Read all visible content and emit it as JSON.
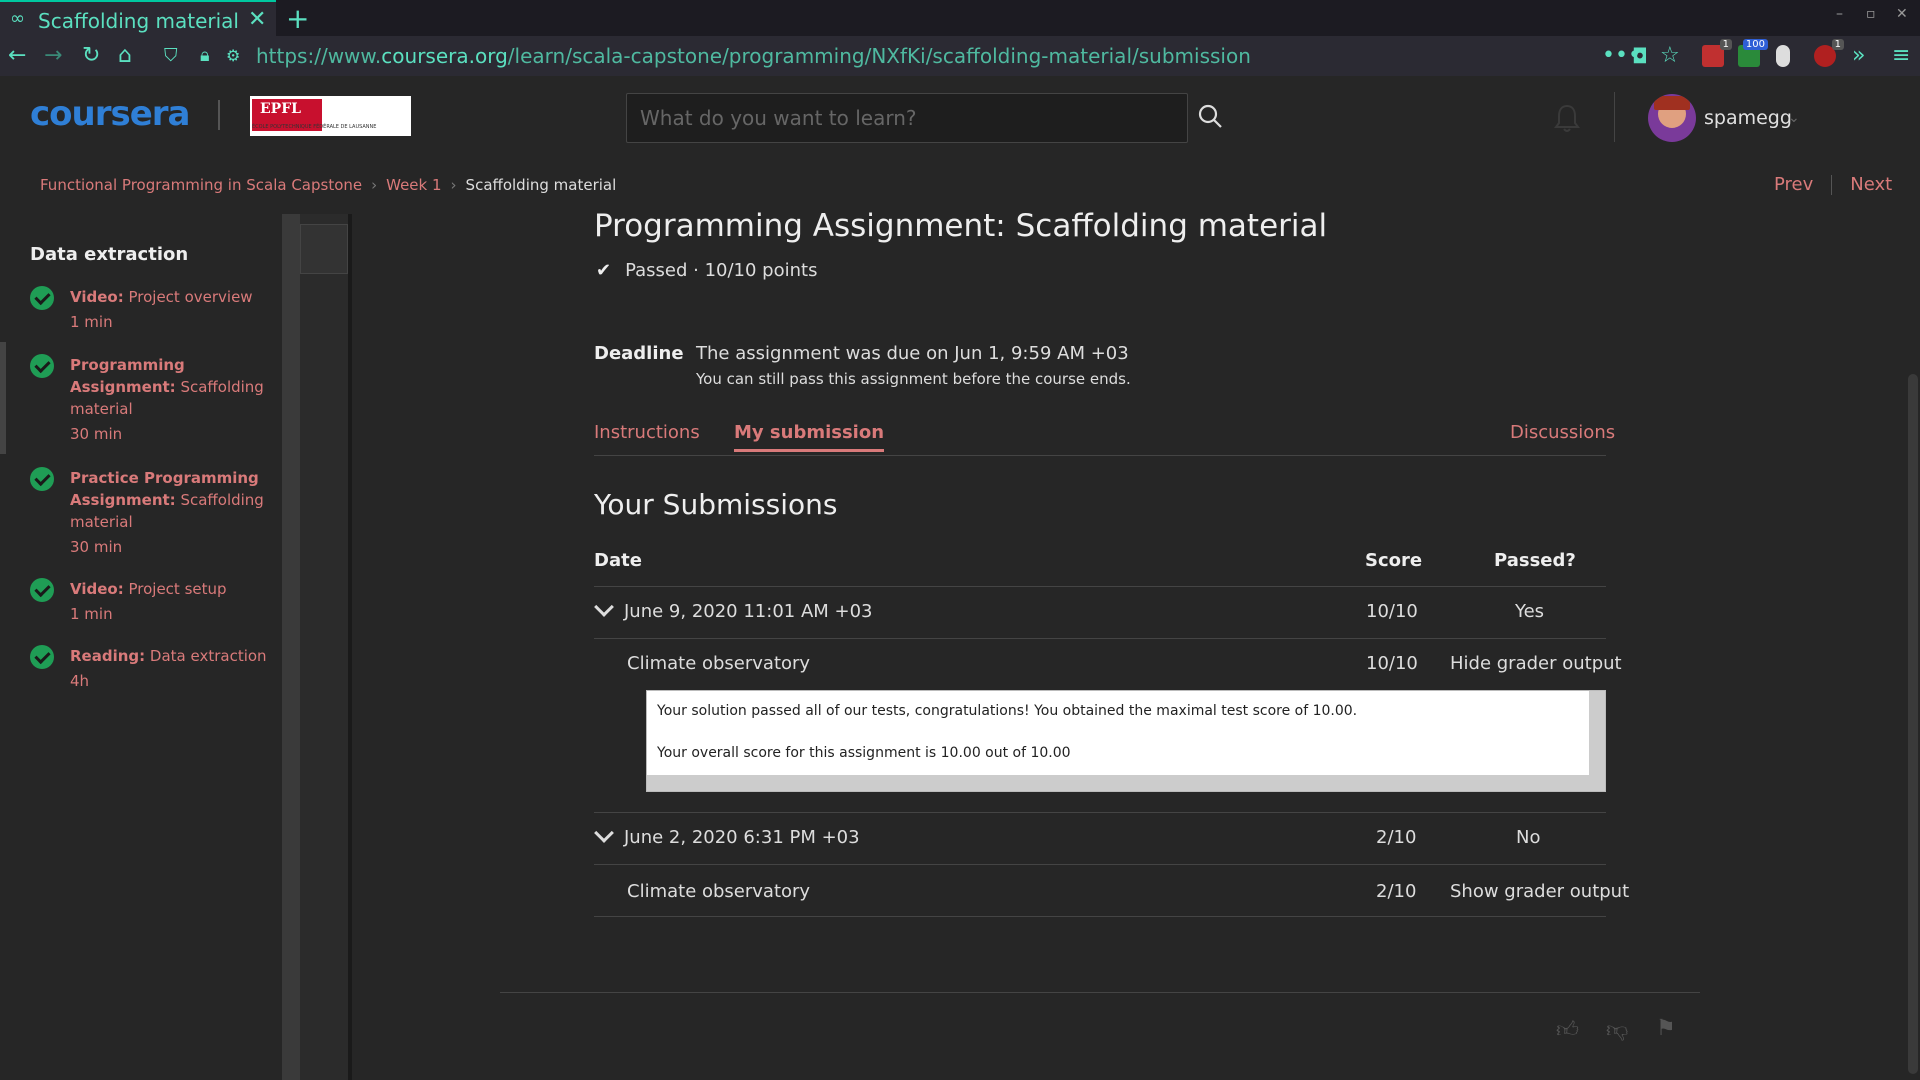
{
  "browser": {
    "tab_title": "Scaffolding material | Coursera",
    "url_prefix": "https://www.",
    "url_domain": "coursera.org",
    "url_path": "/learn/scala-capstone/programming/NXfKi/scaffolding-material/submission",
    "ext_badges": [
      "1",
      "100",
      "1"
    ]
  },
  "header": {
    "logo": "coursera",
    "partner_logo_text": "EPFL",
    "partner_logo_sub": "ÉCOLE POLYTECHNIQUE FÉDÉRALE DE LAUSANNE",
    "search_placeholder": "What do you want to learn?",
    "username": "spamegg"
  },
  "breadcrumb": [
    "Functional Programming in Scala Capstone",
    "Week 1",
    "Scaffolding material"
  ],
  "nav": {
    "prev": "Prev",
    "next": "Next"
  },
  "sidebar": {
    "title": "Data extraction",
    "items": [
      {
        "type": "Video:",
        "name": "Project overview",
        "duration": "1 min"
      },
      {
        "type": "Programming Assignment:",
        "name": "Scaffolding material",
        "duration": "30 min"
      },
      {
        "type": "Practice Programming Assignment:",
        "name": "Scaffolding material",
        "duration": "30 min"
      },
      {
        "type": "Video:",
        "name": "Project setup",
        "duration": "1 min"
      },
      {
        "type": "Reading:",
        "name": "Data extraction",
        "duration": "4h"
      }
    ]
  },
  "main": {
    "title": "Programming Assignment: Scaffolding material",
    "status": "Passed · 10/10 points",
    "deadline_label": "Deadline",
    "deadline_text": "The assignment was due on Jun 1, 9:59 AM +03",
    "deadline_note": "You can still pass this assignment before the course ends.",
    "tabs": [
      "Instructions",
      "My submission",
      "Discussions"
    ],
    "submissions_title": "Your Submissions",
    "columns": [
      "Date",
      "Score",
      "Passed?"
    ],
    "submissions": [
      {
        "date": "June 9, 2020 11:01 AM +03",
        "score": "10/10",
        "passed": "Yes",
        "part": "Climate observatory",
        "part_score": "10/10",
        "action": "Hide grader output",
        "grader_output": [
          "Your solution passed all of our tests, congratulations! You obtained the maximal test score of 10.00.",
          "Your overall score for this assignment is 10.00 out of 10.00"
        ]
      },
      {
        "date": "June 2, 2020 6:31 PM +03",
        "score": "2/10",
        "passed": "No",
        "part": "Climate observatory",
        "part_score": "2/10",
        "action": "Show grader output"
      }
    ]
  },
  "colors": {
    "accent": "#d97a7a",
    "success": "#1f9d55",
    "brand": "#2f7fd6",
    "browser_accent": "#5be0c0"
  }
}
